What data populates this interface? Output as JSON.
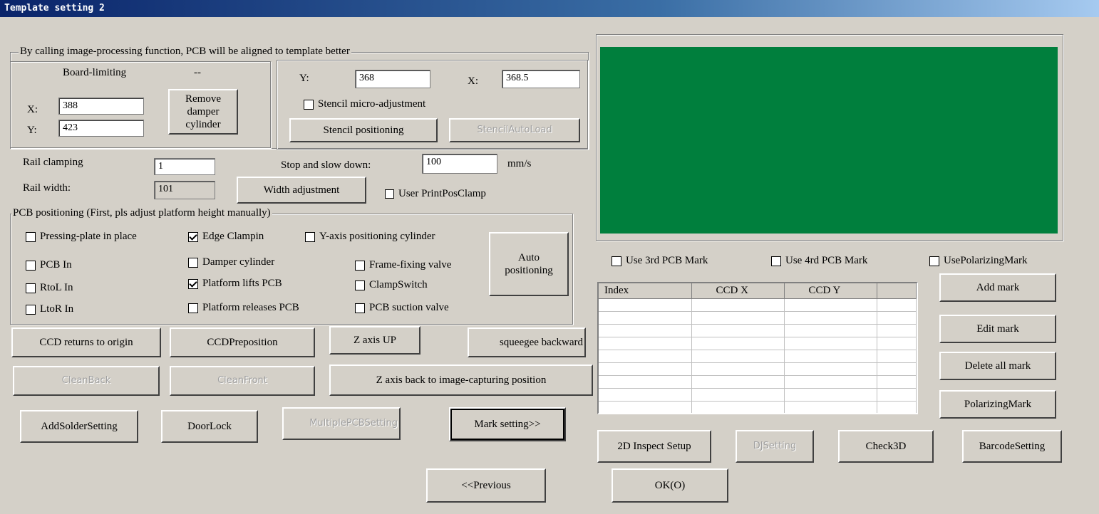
{
  "window": {
    "title": "Template setting 2"
  },
  "align_group": {
    "title": "By calling image-processing function, PCB will be aligned to template better",
    "board_limiting_label": "Board-limiting",
    "board_limiting_value": "--",
    "x_label": "X:",
    "x_value": "388",
    "y_label": "Y:",
    "y_value": "423",
    "remove_damper_label": "Remove damper cylinder"
  },
  "stencil": {
    "y_label": "Y:",
    "y_value": "368",
    "x_label": "X:",
    "x_value": "368.5",
    "micro_adjust_label": "Stencil micro-adjustment",
    "micro_adjust_checked": false,
    "positioning_label": "Stencil positioning",
    "autoload_label": "StencilAutoLoad"
  },
  "rail": {
    "clamping_label": "Rail clamping",
    "clamping_value": "1",
    "width_label": "Rail width:",
    "width_value": "101",
    "stop_label": "Stop and slow down:",
    "stop_value": "100",
    "stop_unit": "mm/s",
    "width_adjust_label": "Width adjustment",
    "user_clamp_label": "User PrintPosClamp"
  },
  "pcb_positioning": {
    "title": "PCB positioning (First, pls adjust platform height manually)",
    "checks": [
      {
        "label": "Pressing-plate in place",
        "checked": false
      },
      {
        "label": "Edge Clampin",
        "checked": true
      },
      {
        "label": "Y-axis positioning cylinder",
        "checked": false
      },
      {
        "label": "PCB In",
        "checked": false
      },
      {
        "label": "Damper cylinder",
        "checked": false
      },
      {
        "label": "Frame-fixing valve",
        "checked": false
      },
      {
        "label": "RtoL In",
        "checked": false
      },
      {
        "label": "Platform lifts PCB",
        "checked": true
      },
      {
        "label": "ClampSwitch",
        "checked": false
      },
      {
        "label": "LtoR In",
        "checked": false
      },
      {
        "label": "Platform releases PCB",
        "checked": false
      },
      {
        "label": "PCB suction valve",
        "checked": false
      }
    ],
    "auto_label": "Auto positioning"
  },
  "actions": {
    "ccd_origin": "CCD returns to origin",
    "ccd_preposition": "CCDPreposition",
    "z_up": "Z axis UP",
    "squeegee_back": "squeegee backward",
    "clean_back": "CleanBack",
    "clean_front": "CleanFront",
    "z_back": "Z axis back to image-capturing position",
    "add_solder": "AddSolderSetting",
    "door_lock": "DoorLock",
    "multiple_pcb": "MultiplePCBSetting",
    "mark_setting": "Mark setting>>"
  },
  "marks": {
    "use3": "Use 3rd PCB  Mark",
    "use4": "Use 4rd PCB  Mark",
    "use_polar": "UsePolarizingMark",
    "columns": [
      "Index",
      "CCD X",
      "CCD Y",
      ""
    ],
    "add": "Add mark",
    "edit": "Edit mark",
    "delete_all": "Delete all mark",
    "polarizing": "PolarizingMark"
  },
  "bottom_right": {
    "inspect2d": "2D  Inspect Setup",
    "dj": "DJSetting",
    "check3d": "Check3D",
    "barcode": "BarcodeSetting"
  },
  "footer": {
    "previous": "<<Previous",
    "ok": "OK(O)"
  },
  "colors": {
    "preview": "#007f3d",
    "title_bar": "#0a246a",
    "face": "#d4d0c8"
  }
}
